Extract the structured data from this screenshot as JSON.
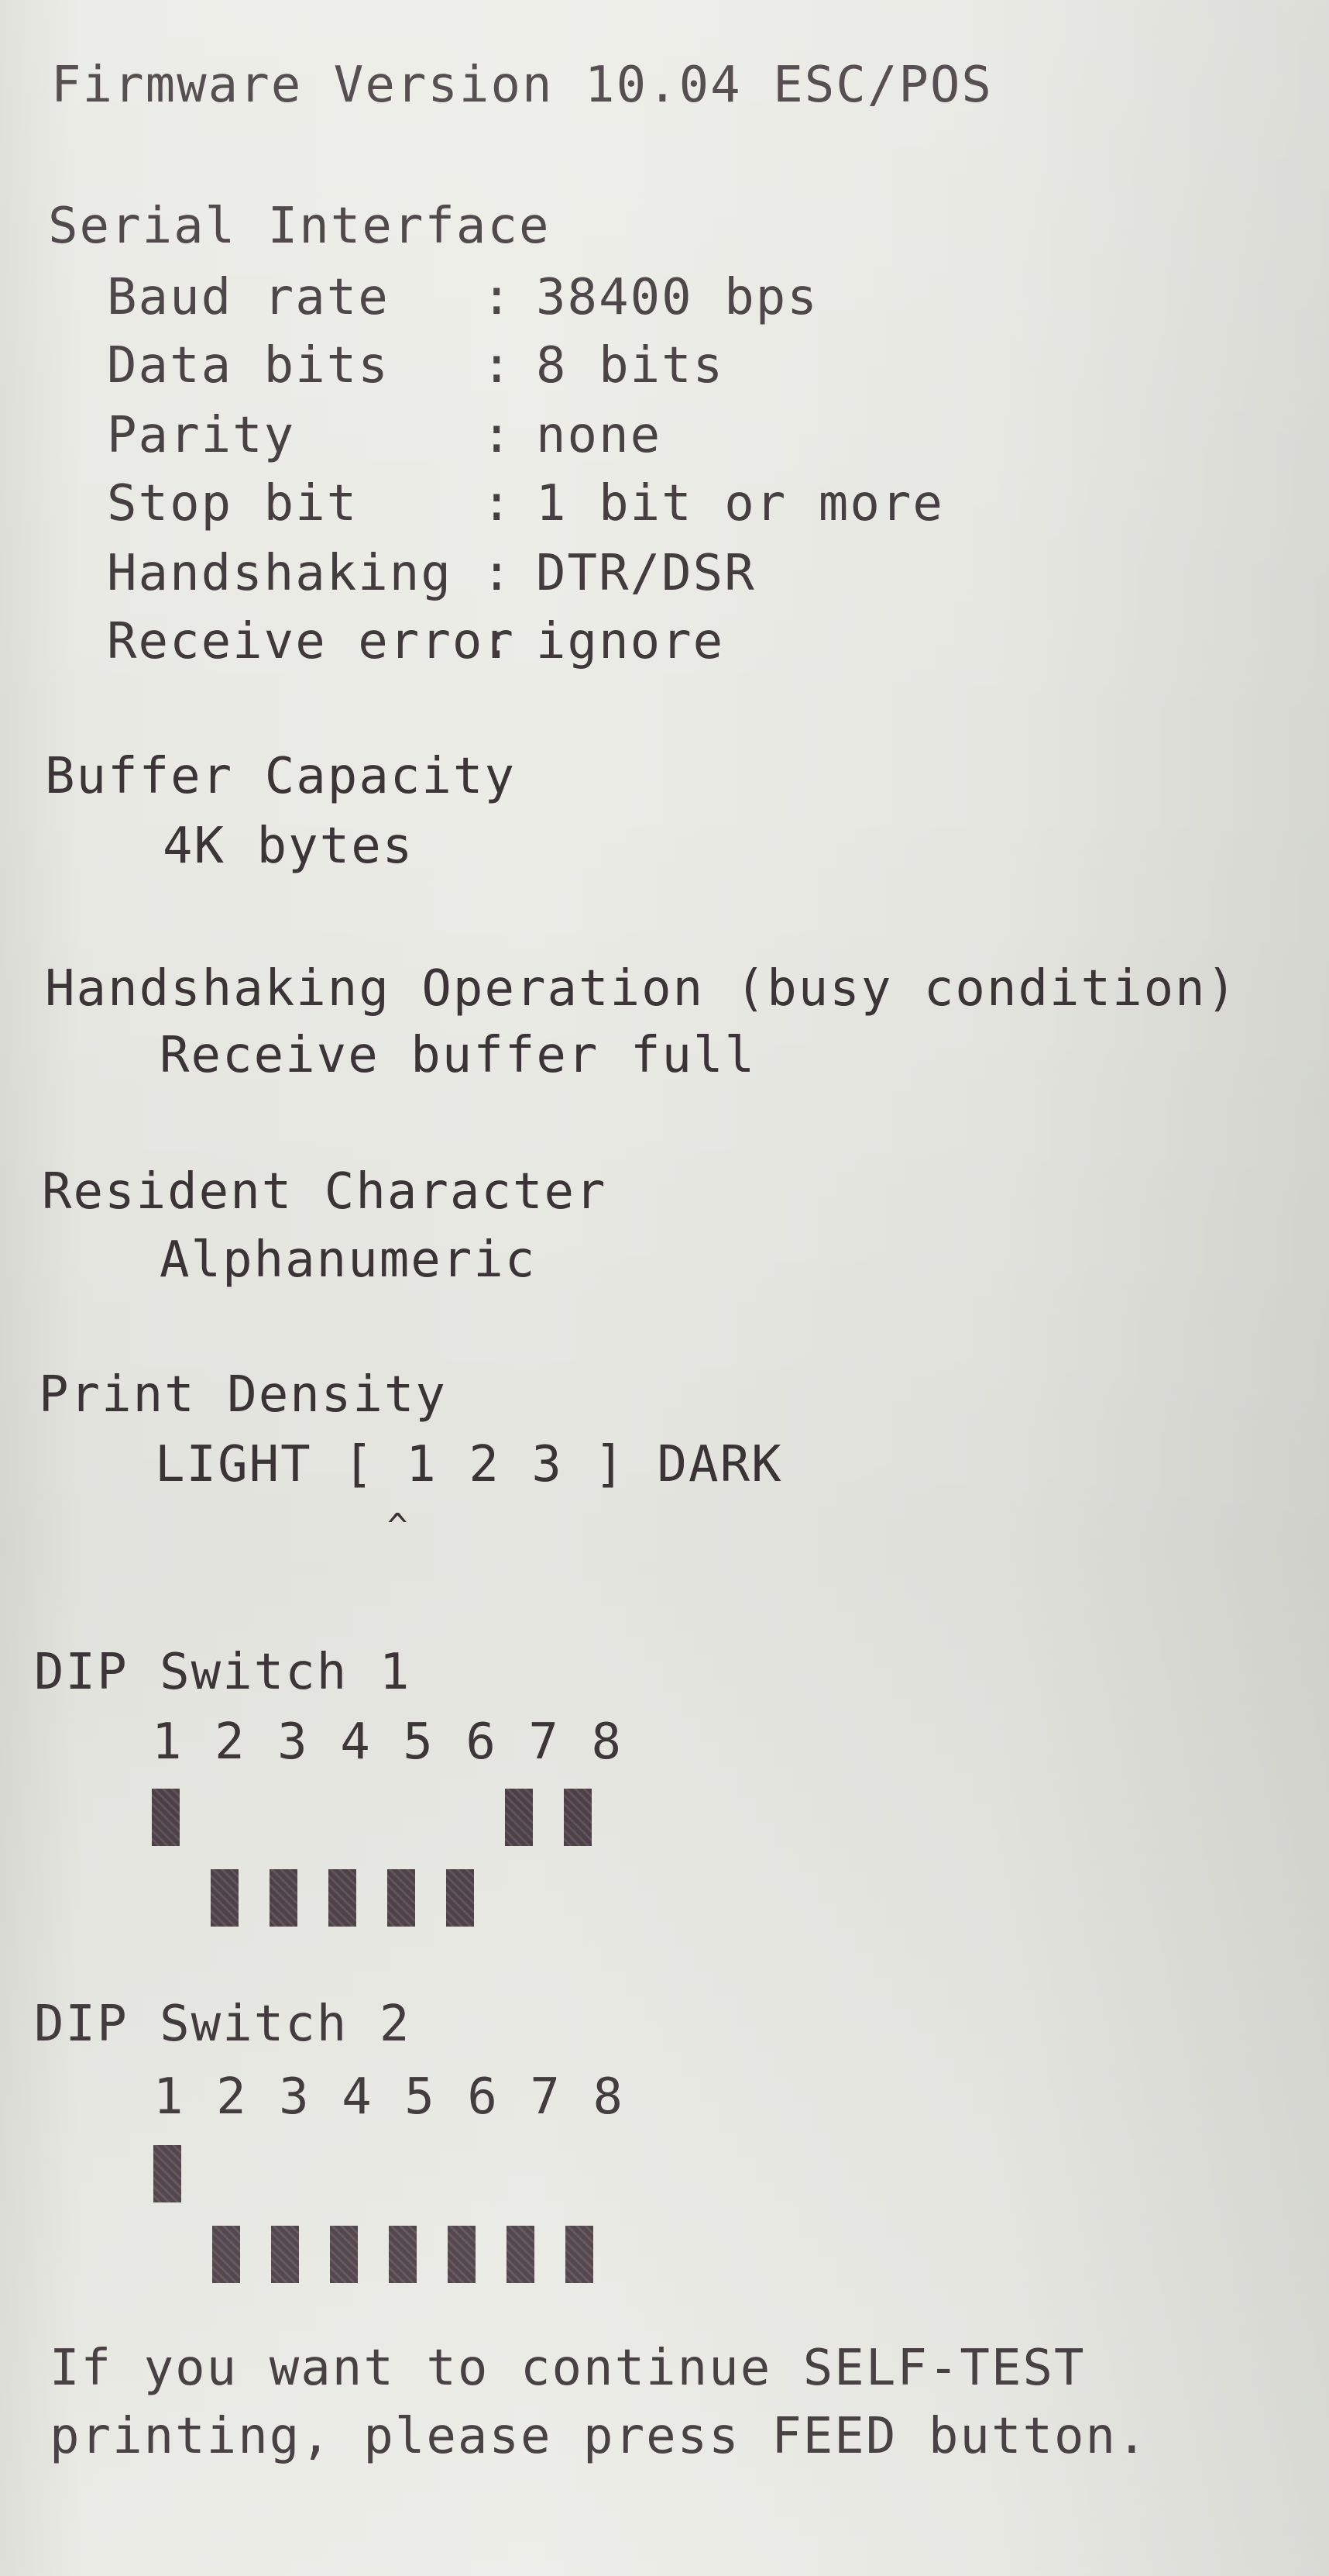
{
  "firmware": "Firmware Version 10.04 ESC/POS",
  "serial": {
    "title": "Serial Interface",
    "rows": [
      {
        "key": "Baud rate",
        "sep": ":",
        "value": "38400 bps"
      },
      {
        "key": "Data bits",
        "sep": ":",
        "value": "8 bits"
      },
      {
        "key": "Parity",
        "sep": ":",
        "value": "none"
      },
      {
        "key": "Stop bit",
        "sep": ":",
        "value": "1 bit or more"
      },
      {
        "key": "Handshaking",
        "sep": ":",
        "value": "DTR/DSR"
      },
      {
        "key": "Receive error",
        "sep": ":",
        "value": "ignore"
      }
    ]
  },
  "buffer": {
    "title": "Buffer Capacity",
    "value": "4K bytes"
  },
  "handshaking_op": {
    "title": "Handshaking Operation (busy condition)",
    "value": "Receive buffer full"
  },
  "resident": {
    "title": "Resident Character",
    "value": "Alphanumeric"
  },
  "density": {
    "title": "Print Density",
    "scale": "LIGHT [ 1 2 3 ] DARK",
    "caret": "^",
    "selected": 1
  },
  "dip1": {
    "title": "DIP Switch 1",
    "numbers": "1 2 3 4 5 6 7 8",
    "states": [
      "on",
      "off",
      "off",
      "off",
      "off",
      "off",
      "on",
      "on"
    ]
  },
  "dip2": {
    "title": "DIP Switch 2",
    "numbers": "1 2 3 4 5 6 7 8",
    "states": [
      "on",
      "off",
      "off",
      "off",
      "off",
      "off",
      "off",
      "off"
    ]
  },
  "footer": {
    "line1": "If you want to continue SELF-TEST",
    "line2": "printing, please press FEED button."
  }
}
